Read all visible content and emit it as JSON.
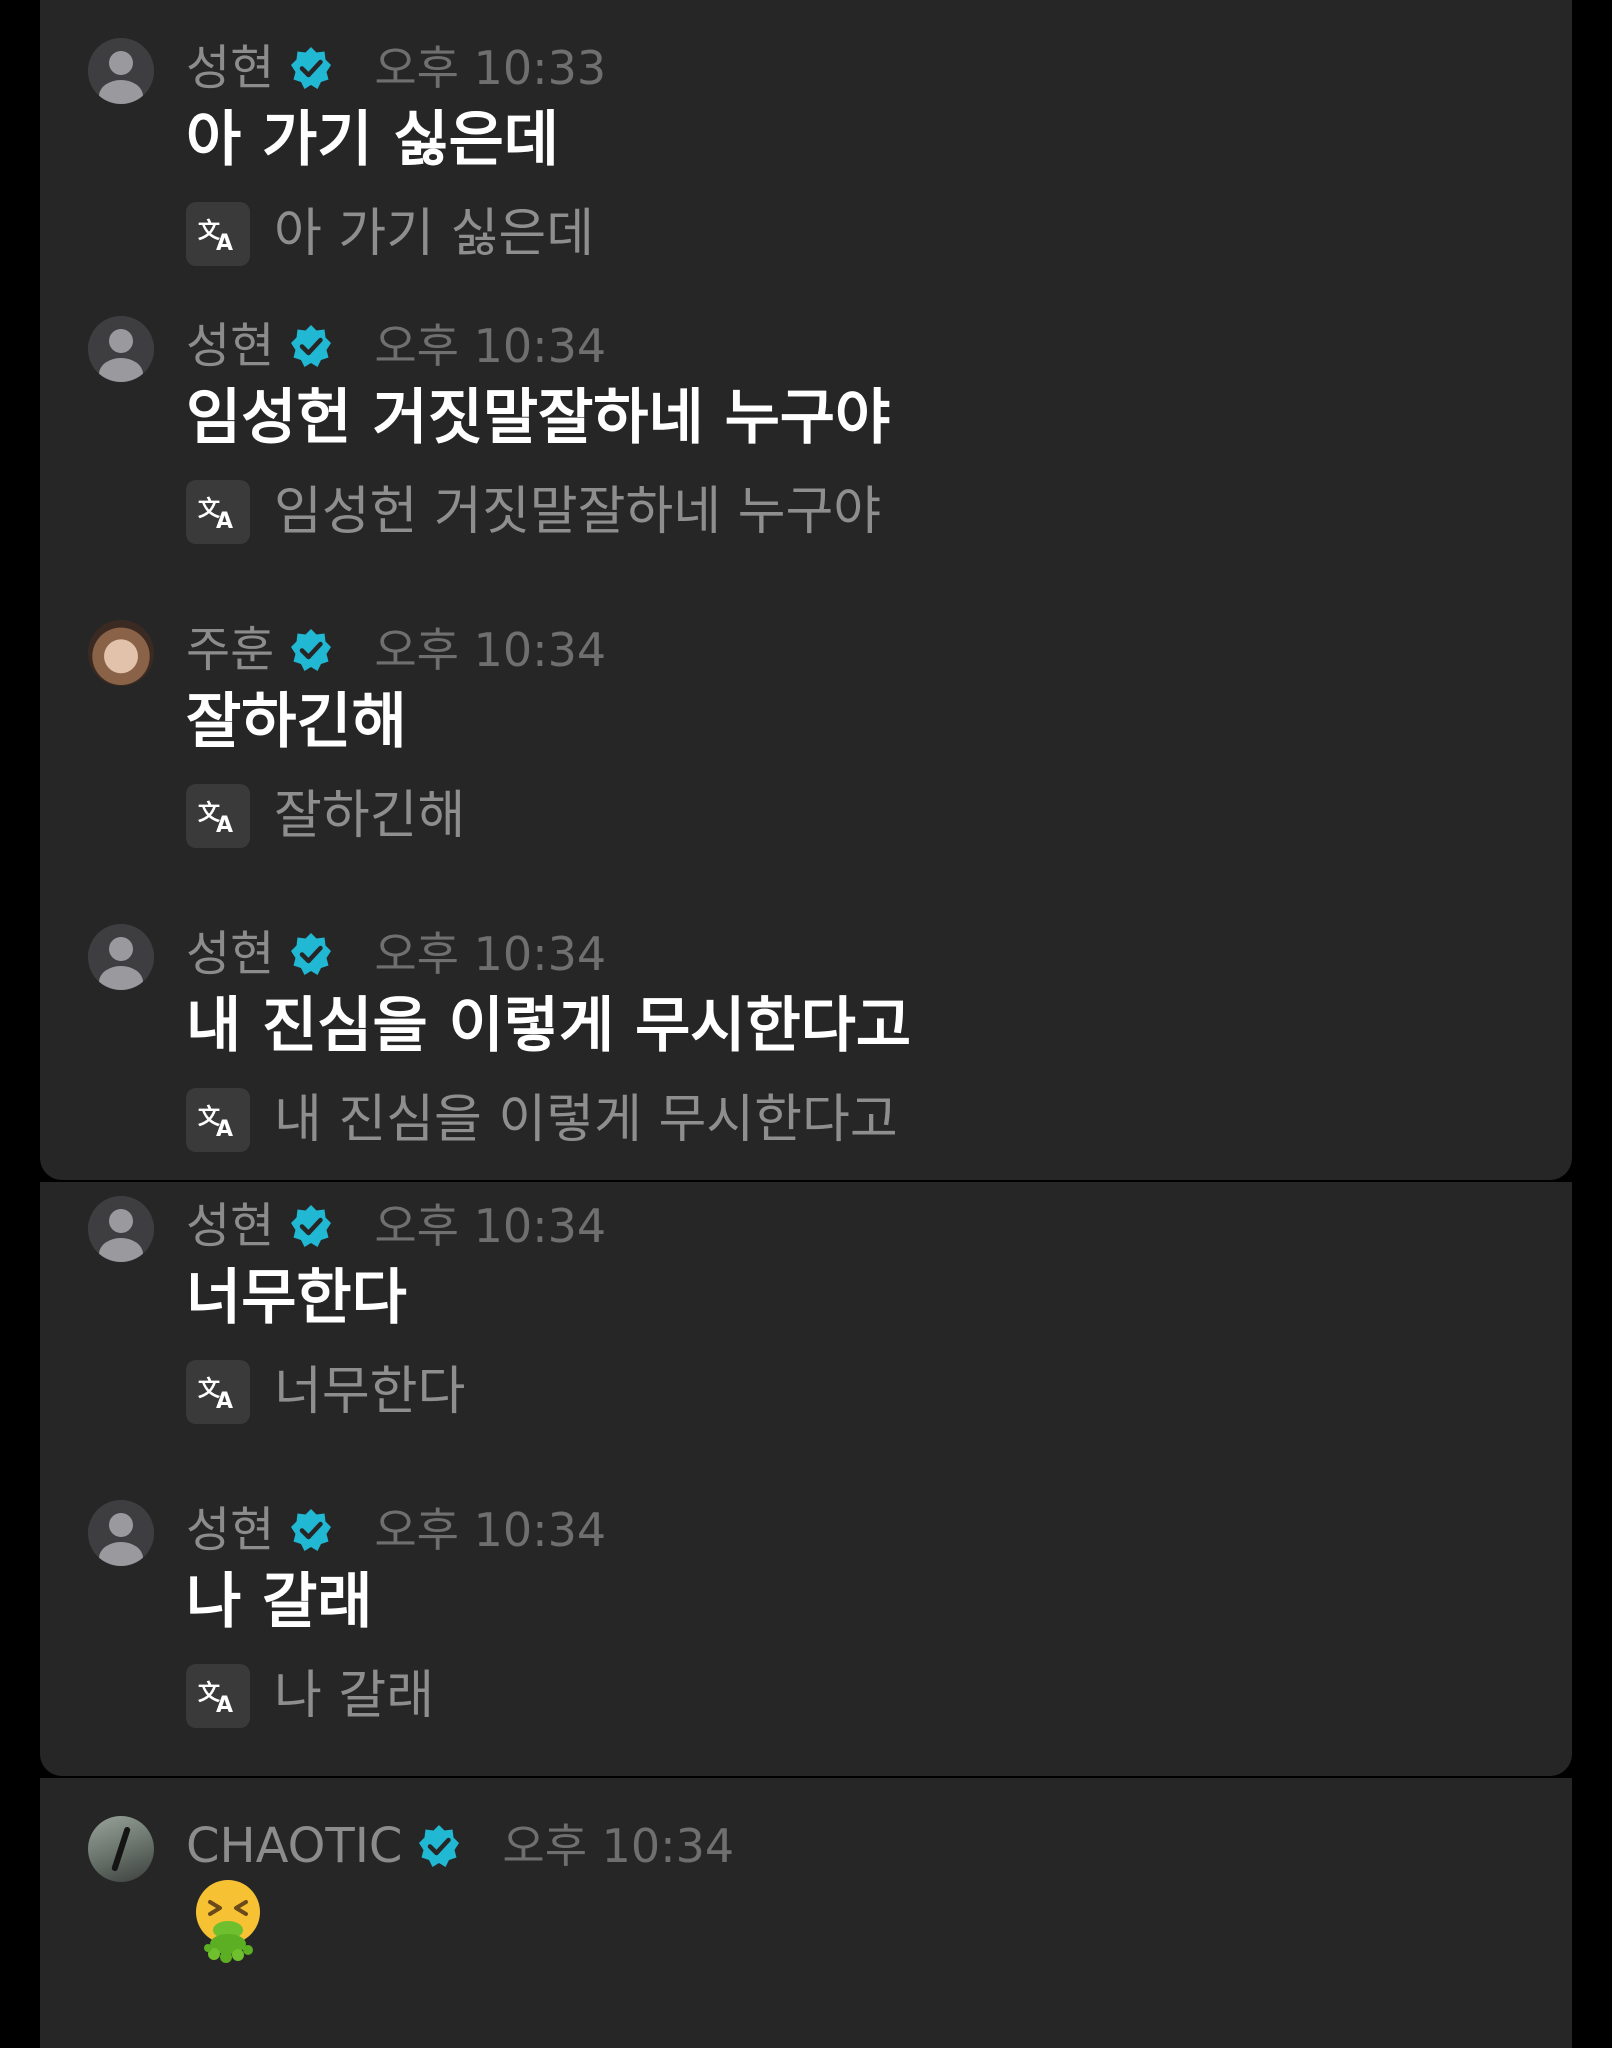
{
  "messages": [
    {
      "name": "성현",
      "time": "오후 10:33",
      "text": "아 가기 싫은데",
      "translation": "아 가기 싫은데"
    },
    {
      "name": "성현",
      "time": "오후 10:34",
      "text": "임성헌 거짓말잘하네 누구야",
      "translation": "임성헌 거짓말잘하네 누구야"
    },
    {
      "name": "주훈",
      "time": "오후 10:34",
      "text": "잘하긴해",
      "translation": "잘하긴해"
    },
    {
      "name": "성현",
      "time": "오후 10:34",
      "text": "내 진심을 이렇게 무시한다고",
      "translation": "내 진심을 이렇게 무시한다고"
    },
    {
      "name": "성현",
      "time": "오후 10:34",
      "text": "너무한다",
      "translation": "너무한다"
    },
    {
      "name": "성현",
      "time": "오후 10:34",
      "text": "나 갈래",
      "translation": "나 갈래"
    },
    {
      "name": "CHAOTIC",
      "time": "오후 10:34",
      "emoji": "vomiting-face"
    }
  ],
  "icons": {
    "verified": "verified-badge-icon",
    "translate": "translate-icon",
    "avatar_default": "person-silhouette-icon"
  },
  "colors": {
    "background": "#000000",
    "panel": "#262626",
    "verified": "#21b8d4",
    "name_text": "#8c8c8c",
    "time_text": "#6f6f6f",
    "message_text": "#ffffff",
    "translation_text": "#8e8e8e"
  }
}
